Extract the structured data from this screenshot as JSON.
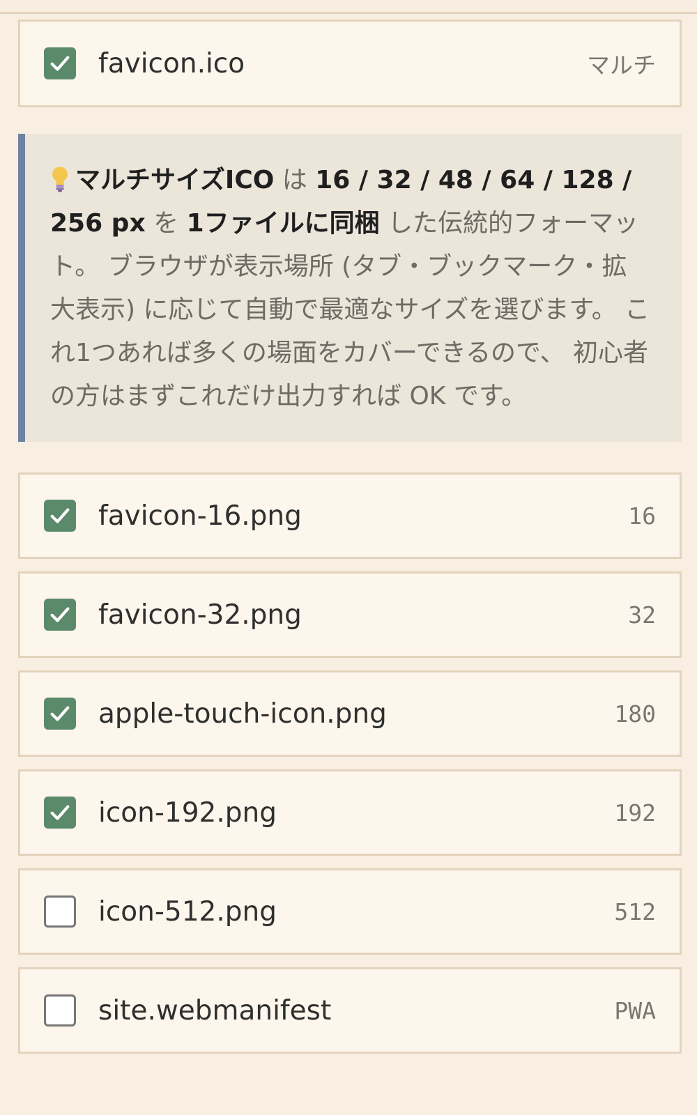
{
  "files": [
    {
      "name": "favicon.ico",
      "tag": "マルチ",
      "checked": true
    },
    {
      "name": "favicon-16.png",
      "tag": "16",
      "checked": true
    },
    {
      "name": "favicon-32.png",
      "tag": "32",
      "checked": true
    },
    {
      "name": "apple-touch-icon.png",
      "tag": "180",
      "checked": true
    },
    {
      "name": "icon-192.png",
      "tag": "192",
      "checked": true
    },
    {
      "name": "icon-512.png",
      "tag": "512",
      "checked": false
    },
    {
      "name": "site.webmanifest",
      "tag": "PWA",
      "checked": false
    }
  ],
  "tip": {
    "icon": "lightbulb-icon",
    "bold1": "マルチサイズICO",
    "text1": " は ",
    "bold2": "16 / 32 / 48 / 64 / 128 / 256 px",
    "text2": " を ",
    "bold3": "1ファイルに同梱",
    "text3": " した伝統的フォーマット。 ブラウザが表示場所 (タブ・ブックマーク・拡大表示) に応じて自動で最適なサイズを選びます。 これ1つあれば多くの場面をカバーできるので、 初心者の方はまずこれだけ出力すれば OK です。"
  },
  "colors": {
    "background": "#f8efe2",
    "card": "#fdf6ec",
    "checkbox_checked": "#5a8a6a",
    "tip_background": "#ebe5da",
    "tip_accent": "#6f82a0"
  }
}
